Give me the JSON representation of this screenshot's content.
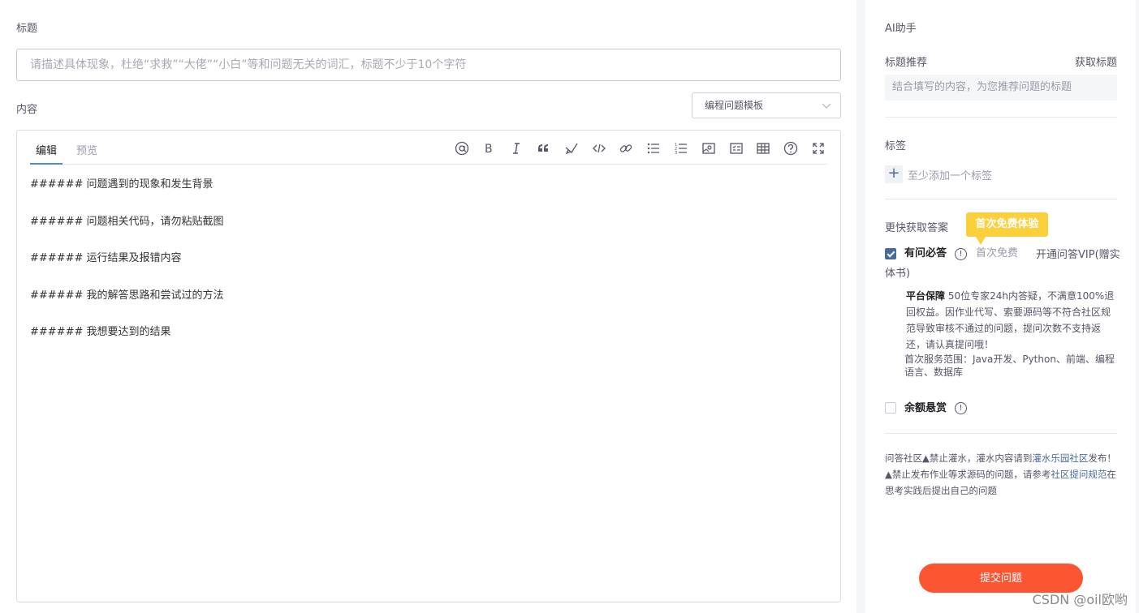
{
  "main": {
    "title_label": "标题",
    "title_placeholder": "请描述具体现象，杜绝“求救”“大佬”“小白”等和问题无关的词汇，标题不少于10个字符",
    "content_label": "内容",
    "template_select": "编程问题模板",
    "tabs": [
      {
        "label": "编辑"
      },
      {
        "label": "预览"
      }
    ],
    "toolbar_icons": [
      "at-icon",
      "bold-icon",
      "italic-icon",
      "quote-icon",
      "brush-icon",
      "code-icon",
      "link-icon",
      "unordered-list-icon",
      "ordered-list-icon",
      "image-icon",
      "checklist-icon",
      "table-icon",
      "help-icon",
      "fullscreen-icon"
    ],
    "content_lines": [
      "###### 问题遇到的现象和发生背景",
      "###### 问题相关代码，请勿粘贴截图",
      "###### 运行结果及报错内容",
      "###### 我的解答思路和尝试过的方法",
      "###### 我想要达到的结果"
    ]
  },
  "side": {
    "ai_label": "AI助手",
    "title_rec_label": "标题推荐",
    "get_title_link": "获取标题",
    "rec_placeholder": "结合填写的内容，为您推荐问题的标题",
    "tags_label": "标签",
    "add_tag": "至少添加一个标签",
    "faster_label": "更快获取答案",
    "badge": "首次免费体验",
    "option1": {
      "name": "有问必答",
      "checked": true,
      "free": "首次免费",
      "vip_link": "开通问答VIP(赠实体书)",
      "guarantee_title": "平台保障",
      "guarantee_text": " 50位专家24h内答疑，不满意100%退回权益。因作业代写、索要源码等不符合社区规范导致审核不通过的问题，提问次数不支持返还，请认真提问哦！",
      "scope": "首次服务范围：Java开发、Python、前端、编程语言、数据库"
    },
    "option2": {
      "name": "余额悬赏",
      "checked": false
    },
    "notice": {
      "part1": "问答社区▲禁止灌水，灌水内容请到",
      "link1": "灌水乐园社区",
      "part2": "发布！▲禁止发布作业等求源码的问题，请参考",
      "link2": "社区提问规范",
      "part3": "在思考实践后提出自己的问题"
    },
    "submit": "提交问题"
  },
  "watermark": "CSDN @oil欧哟",
  "colors": {
    "accent": "#fc5531",
    "checkbox": "#4a6b9a",
    "badge": "#fccf3c",
    "tab_underline": "#4a8ed8"
  }
}
